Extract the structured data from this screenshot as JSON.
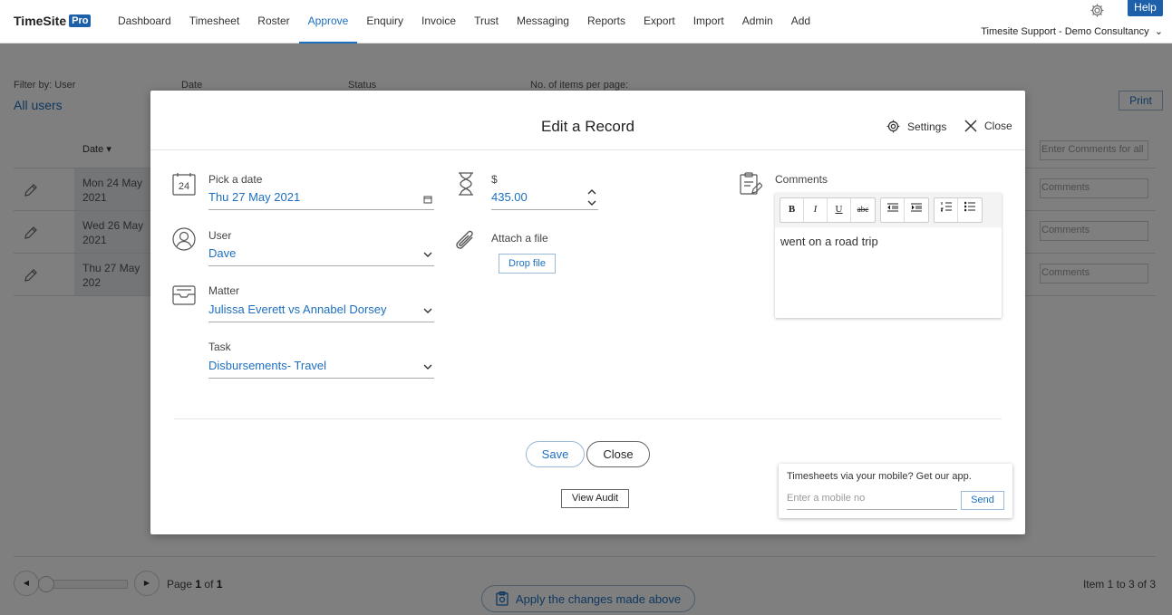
{
  "nav": {
    "logo": "TimeSite",
    "logo_badge": "Pro",
    "items": [
      "Dashboard",
      "Timesheet",
      "Roster",
      "Approve",
      "Enquiry",
      "Invoice",
      "Trust",
      "Messaging",
      "Reports",
      "Export",
      "Import",
      "Admin",
      "Add"
    ],
    "active": "Approve",
    "help": "Help",
    "account": "Timesite Support - Demo Consultancy"
  },
  "filters": {
    "filter_by": "Filter by: User",
    "user_value": "All users",
    "date": "Date",
    "status": "Status",
    "items_per_page": "No. of items per page:",
    "print": "Print"
  },
  "table": {
    "date_header": "Date",
    "comments_all_placeholder": "Enter Comments for all",
    "rows": [
      {
        "date": "Mon 24 May 2021",
        "comment_placeholder": "Comments"
      },
      {
        "date": "Wed 26 May 2021",
        "comment_placeholder": "Comments"
      },
      {
        "date": "Thu 27 May 202",
        "comment_placeholder": "Comments"
      }
    ]
  },
  "pager": {
    "prev": "◀",
    "next": "▶",
    "page_prefix": "Page",
    "page_current": "1",
    "page_of": "of",
    "page_total": "1",
    "items_info": "Item 1 to 3 of 3",
    "apply": "Apply the changes made above"
  },
  "modal": {
    "title": "Edit a Record",
    "settings": "Settings",
    "close": "Close",
    "date_label": "Pick a date",
    "date_value": "Thu  27 May 2021",
    "calendar_day": "24",
    "amount_label": "$",
    "amount_value": "435.00",
    "user_label": "User",
    "user_value": "Dave",
    "attach_label": "Attach a file",
    "drop_file": "Drop file",
    "matter_label": "Matter",
    "matter_value": "Julissa Everett vs Annabel Dorsey",
    "task_label": "Task",
    "task_value": "Disbursements- Travel",
    "comments_label": "Comments",
    "comments_text": "went on a road trip",
    "toolbar": {
      "bold": "B",
      "italic": "I",
      "underline": "U",
      "strike": "abc"
    },
    "save": "Save",
    "close_button": "Close",
    "view_audit": "View Audit"
  },
  "app_widget": {
    "text": "Timesheets via your mobile? Get our app.",
    "placeholder": "Enter a mobile no",
    "send": "Send"
  }
}
